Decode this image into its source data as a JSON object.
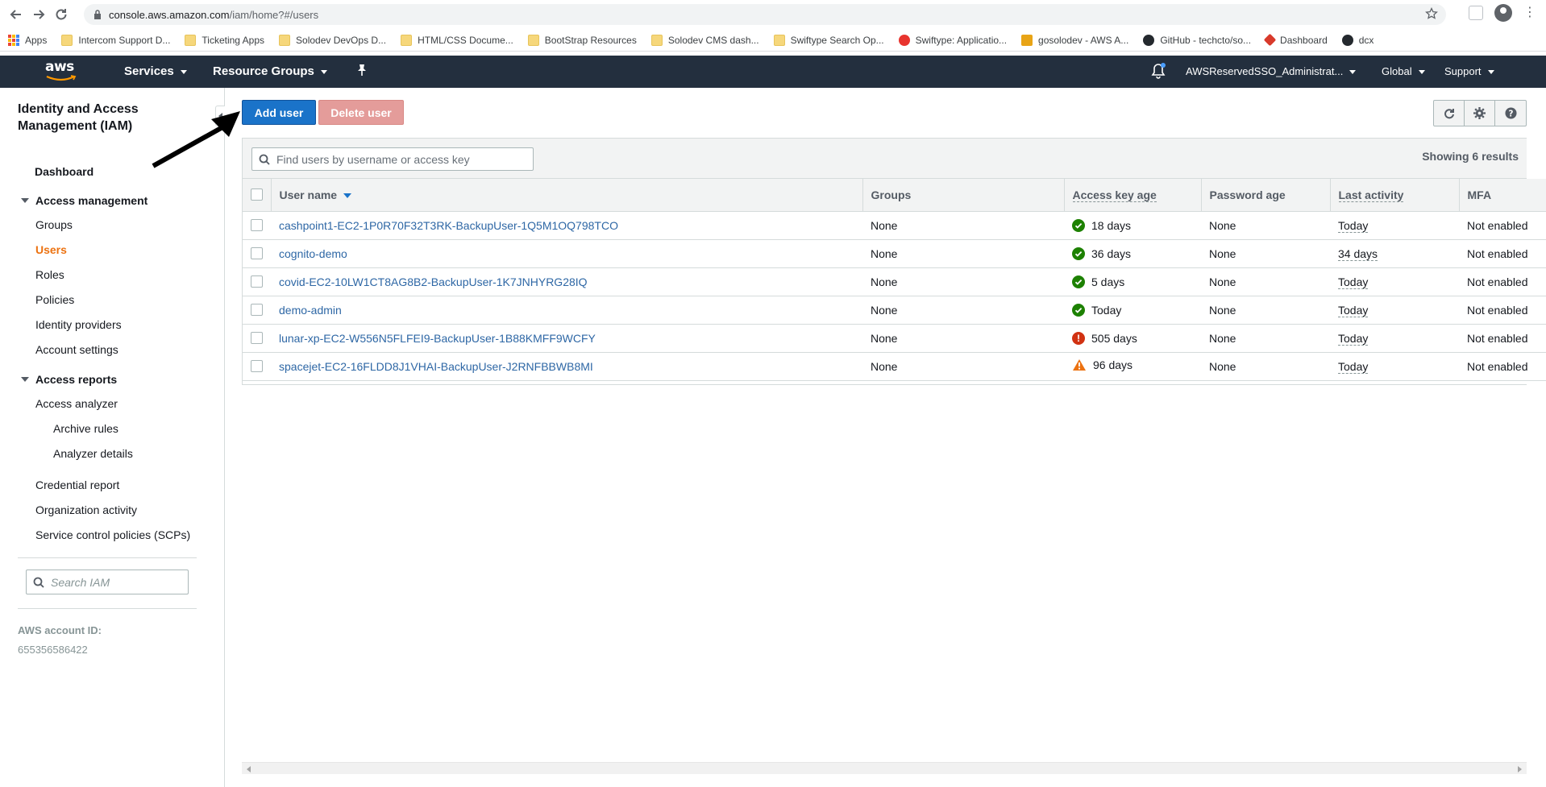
{
  "browser": {
    "url_host": "console.aws.amazon.com",
    "url_path": "/iam/home?#/users",
    "bookmarks": [
      {
        "label": "Apps",
        "icon": "apps-grid-icon"
      },
      {
        "label": "Intercom Support D...",
        "icon": "folder-icon"
      },
      {
        "label": "Ticketing Apps",
        "icon": "folder-icon"
      },
      {
        "label": "Solodev DevOps D...",
        "icon": "folder-icon"
      },
      {
        "label": "HTML/CSS Docume...",
        "icon": "folder-icon"
      },
      {
        "label": "BootStrap Resources",
        "icon": "folder-icon"
      },
      {
        "label": "Solodev CMS dash...",
        "icon": "folder-icon"
      },
      {
        "label": "Swiftype Search Op...",
        "icon": "folder-icon"
      },
      {
        "label": "Swiftype: Applicatio...",
        "icon": "swiftype-icon"
      },
      {
        "label": "gosolodev - AWS A...",
        "icon": "aws-box-icon"
      },
      {
        "label": "GitHub - techcto/so...",
        "icon": "github-icon"
      },
      {
        "label": "Dashboard",
        "icon": "dashboard-icon"
      },
      {
        "label": "dcx",
        "icon": "github-icon"
      }
    ]
  },
  "awsnav": {
    "logo": "aws",
    "services": "Services",
    "resource_groups": "Resource Groups",
    "account": "AWSReservedSSO_Administrat...",
    "region": "Global",
    "support": "Support"
  },
  "sidebar": {
    "title": "Identity and Access Management (IAM)",
    "dashboard": "Dashboard",
    "access_management": {
      "label": "Access management",
      "items": [
        "Groups",
        "Users",
        "Roles",
        "Policies",
        "Identity providers",
        "Account settings"
      ],
      "active": "Users"
    },
    "access_reports": {
      "label": "Access reports",
      "access_analyzer": "Access analyzer",
      "sub_items": [
        "Archive rules",
        "Analyzer details"
      ],
      "items": [
        "Credential report",
        "Organization activity",
        "Service control policies (SCPs)"
      ]
    },
    "search_placeholder": "Search IAM",
    "account_id_label": "AWS account ID:",
    "account_id": "655356586422"
  },
  "toolbar": {
    "add_user": "Add user",
    "delete_user": "Delete user"
  },
  "table": {
    "search_placeholder": "Find users by username or access key",
    "showing": "Showing 6 results",
    "columns": [
      "User name",
      "Groups",
      "Access key age",
      "Password age",
      "Last activity",
      "MFA"
    ],
    "rows": [
      {
        "user": "cashpoint1-EC2-1P0R70F32T3RK-BackupUser-1Q5M1OQ798TCO",
        "groups": "None",
        "key_status": "ok",
        "key_age": "18 days",
        "password_age": "None",
        "last_activity": "Today",
        "mfa": "Not enabled"
      },
      {
        "user": "cognito-demo",
        "groups": "None",
        "key_status": "ok",
        "key_age": "36 days",
        "password_age": "None",
        "last_activity": "34 days",
        "mfa": "Not enabled"
      },
      {
        "user": "covid-EC2-10LW1CT8AG8B2-BackupUser-1K7JNHYRG28IQ",
        "groups": "None",
        "key_status": "ok",
        "key_age": "5 days",
        "password_age": "None",
        "last_activity": "Today",
        "mfa": "Not enabled"
      },
      {
        "user": "demo-admin",
        "groups": "None",
        "key_status": "ok",
        "key_age": "Today",
        "password_age": "None",
        "last_activity": "Today",
        "mfa": "Not enabled"
      },
      {
        "user": "lunar-xp-EC2-W556N5FLFEI9-BackupUser-1B88KMFF9WCFY",
        "groups": "None",
        "key_status": "error",
        "key_age": "505 days",
        "password_age": "None",
        "last_activity": "Today",
        "mfa": "Not enabled"
      },
      {
        "user": "spacejet-EC2-16FLDD8J1VHAI-BackupUser-J2RNFBBWB8MI",
        "groups": "None",
        "key_status": "warning",
        "key_age": "96 days",
        "password_age": "None",
        "last_activity": "Today",
        "mfa": "Not enabled"
      }
    ]
  },
  "colors": {
    "aws_nav": "#232f3e",
    "primary": "#1a73c9",
    "active_nav": "#ec7211",
    "link": "#2e67a5",
    "ok": "#1d8102",
    "error": "#d13212",
    "warning": "#ec7211"
  }
}
